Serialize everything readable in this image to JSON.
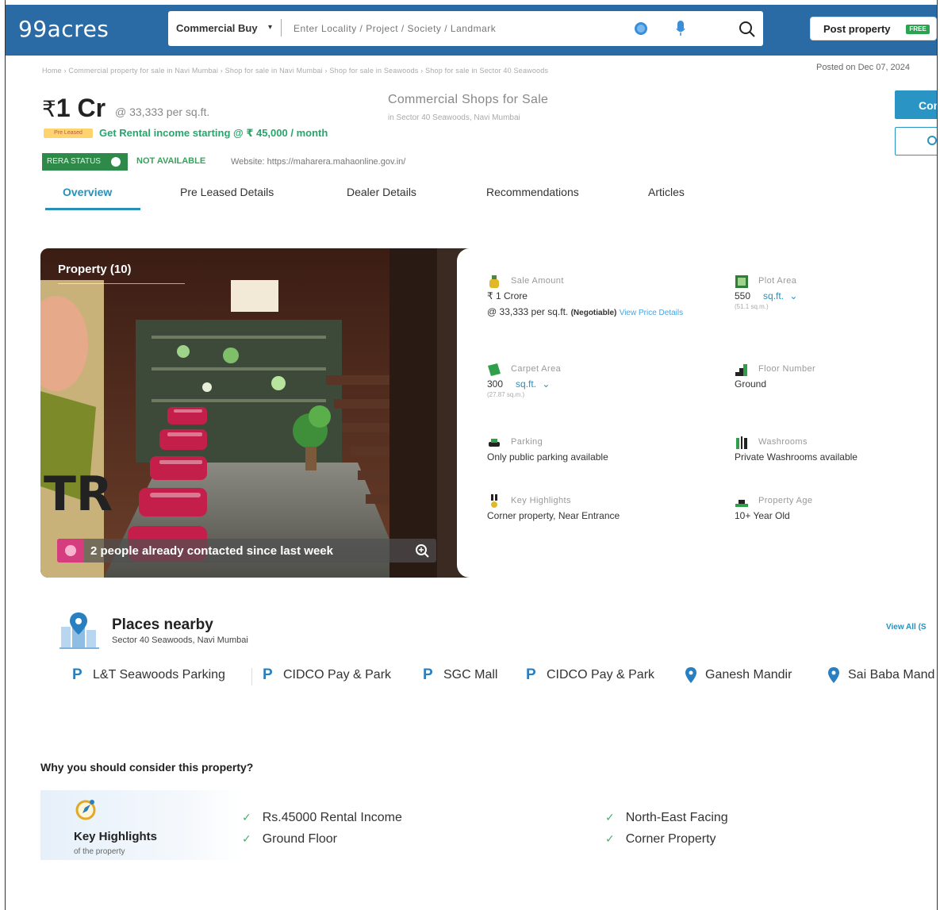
{
  "header": {
    "logo": "99acres",
    "search_type": "Commercial Buy",
    "search_placeholder": "Enter Locality / Project / Society / Landmark",
    "post_property": "Post property",
    "post_badge": "FREE"
  },
  "breadcrumb": "Home › Commercial property for sale in Navi Mumbai › Shop for sale in Navi Mumbai › Shop for sale in Seawoods › Shop for sale in Sector 40 Seawoods",
  "posted_on": "Posted on Dec 07, 2024",
  "listing": {
    "price_symbol": "₹",
    "price": "1 Cr",
    "price_per_sqft": "@ 33,333 per sq.ft.",
    "title": "Commercial Shops for Sale",
    "subtitle": "in Sector 40 Seawoods, Navi Mumbai",
    "pre_leased_badge": "Pre Leased",
    "rental_text": "Get Rental income starting @ ₹ 45,000 / month",
    "contact_label": "Cont",
    "rera_label": "RERA STATUS",
    "rera_value": "NOT AVAILABLE",
    "website": "Website: https://maharera.mahaonline.gov.in/"
  },
  "tabs": [
    {
      "label": "Overview"
    },
    {
      "label": "Pre Leased Details"
    },
    {
      "label": "Dealer Details"
    },
    {
      "label": "Recommendations"
    },
    {
      "label": "Articles"
    }
  ],
  "photo": {
    "title": "Property (10)",
    "contacted": "2 people already contacted since last week"
  },
  "details": {
    "sale_amount_label": "Sale Amount",
    "sale_amount_value": "₹ 1 Crore",
    "sale_amount_ppsf": "@ 33,333 per sq.ft.",
    "negotiable": "(Negotiable)",
    "view_price": "View Price Details",
    "plot_area_label": "Plot Area",
    "plot_area_value": "550",
    "plot_area_unit": "sq.ft.",
    "plot_area_sub": "(51.1 sq.m.)",
    "carpet_area_label": "Carpet Area",
    "carpet_area_value": "300",
    "carpet_area_unit": "sq.ft.",
    "carpet_area_sub": "(27.87 sq.m.)",
    "floor_label": "Floor Number",
    "floor_value": "Ground",
    "parking_label": "Parking",
    "parking_value": "Only public parking available",
    "washrooms_label": "Washrooms",
    "washrooms_value": "Private Washrooms available",
    "highlights_label": "Key Highlights",
    "highlights_value": "Corner property, Near Entrance",
    "age_label": "Property Age",
    "age_value": "10+ Year Old"
  },
  "places": {
    "title": "Places nearby",
    "subtitle": "Sector 40 Seawoods, Navi Mumbai",
    "view_all": "View All (S",
    "items": [
      {
        "icon": "P",
        "label": "L&T Seawoods Parking"
      },
      {
        "icon": "P",
        "label": "CIDCO Pay & Park"
      },
      {
        "icon": "P",
        "label": "SGC Mall"
      },
      {
        "icon": "P",
        "label": "CIDCO Pay & Park"
      },
      {
        "icon": "pin",
        "label": "Ganesh Mandir"
      },
      {
        "icon": "pin",
        "label": "Sai Baba Mand"
      }
    ]
  },
  "why": {
    "title": "Why you should consider this property?",
    "box_title": "Key Highlights",
    "box_sub": "of the property",
    "highlights": [
      "Rs.45000 Rental Income",
      "Ground Floor",
      "North-East Facing",
      "Corner Property"
    ]
  },
  "colors": {
    "brand_blue": "#2a6ba5",
    "accent": "#2a8fb8",
    "green": "#26a66b"
  }
}
